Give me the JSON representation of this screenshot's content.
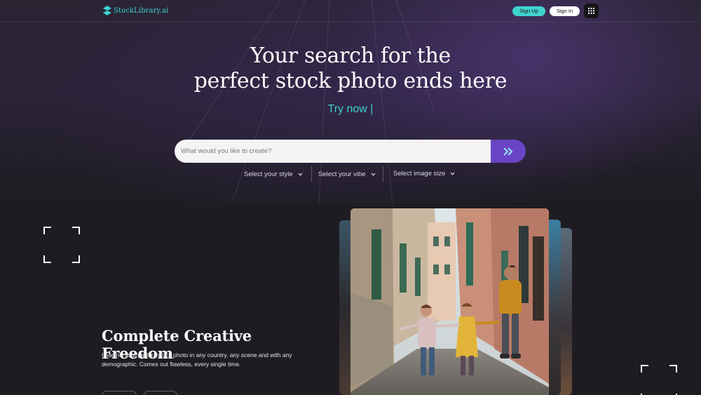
{
  "header": {
    "logo_text": "StockLibrary.ai",
    "signup_label": "Sign Up",
    "signin_label": "Sign In",
    "apps_icon": "grid-icon"
  },
  "hero": {
    "headline_line1": "Your search for the",
    "headline_line2": "perfect stock photo ends here",
    "tagline": "Try now |"
  },
  "search": {
    "placeholder": "What would you like to create?",
    "value": "",
    "submit_icon": "double-chevron-right-icon"
  },
  "filters": [
    {
      "label": "Select your style"
    },
    {
      "label": "Select your vibe"
    },
    {
      "label": "Select image size"
    }
  ],
  "feature": {
    "title": "Complete Creative Freedom",
    "description": "Imagine your perfect stock photo in any country, any scene and with any demographic. Comes out flawless, every single time."
  },
  "colors": {
    "accent": "#3fd3cf",
    "primary": "#6a44c4",
    "background": "#1e1c22"
  }
}
